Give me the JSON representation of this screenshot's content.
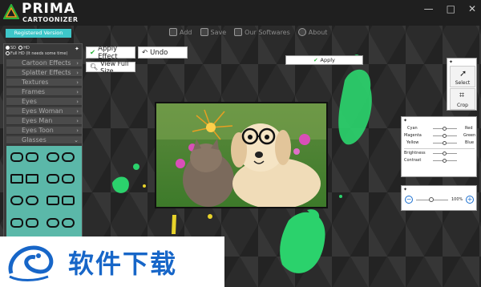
{
  "app": {
    "logo_main": "PRIMA",
    "logo_sub": "CARTOONIZER",
    "registered": "Registered Version"
  },
  "window_controls": [
    "—",
    "□",
    "✕"
  ],
  "toolbar": {
    "items": [
      {
        "label": "Add",
        "icon": "add-image-icon"
      },
      {
        "label": "Save",
        "icon": "save-icon"
      },
      {
        "label": "Our Softwares",
        "icon": "softwares-icon"
      },
      {
        "label": "About",
        "icon": "info-icon"
      }
    ]
  },
  "resolution": {
    "sd": "SD",
    "hd": "HD",
    "fullhd": "Full HD (It needs some time)",
    "selected": "SD"
  },
  "menu": {
    "items": [
      "Cartoon Effects",
      "Splatter Effects",
      "Textures",
      "Frames",
      "Eyes",
      "Eyes Woman",
      "Eyes Man",
      "Eyes Toon",
      "Glasses"
    ]
  },
  "actions": {
    "apply_effect": "Apply Effect",
    "undo": "Undo",
    "view_full_size": "View Full Size",
    "apply": "Apply"
  },
  "tools": {
    "select": "Select",
    "crop": "Crop"
  },
  "color_adjust": {
    "cyan": "Cyan",
    "red": "Red",
    "magenta": "Magenta",
    "green": "Green",
    "yellow": "Yellow",
    "blue": "Blue",
    "brightness": "Brightness",
    "contrast": "Contrast"
  },
  "zoom": {
    "value": "100%"
  },
  "watermark": {
    "text": "软件下载"
  },
  "colors": {
    "accent": "#3ec7c9",
    "splash_green": "#2bd26c",
    "glasses_bg": "#5bb8a9"
  }
}
